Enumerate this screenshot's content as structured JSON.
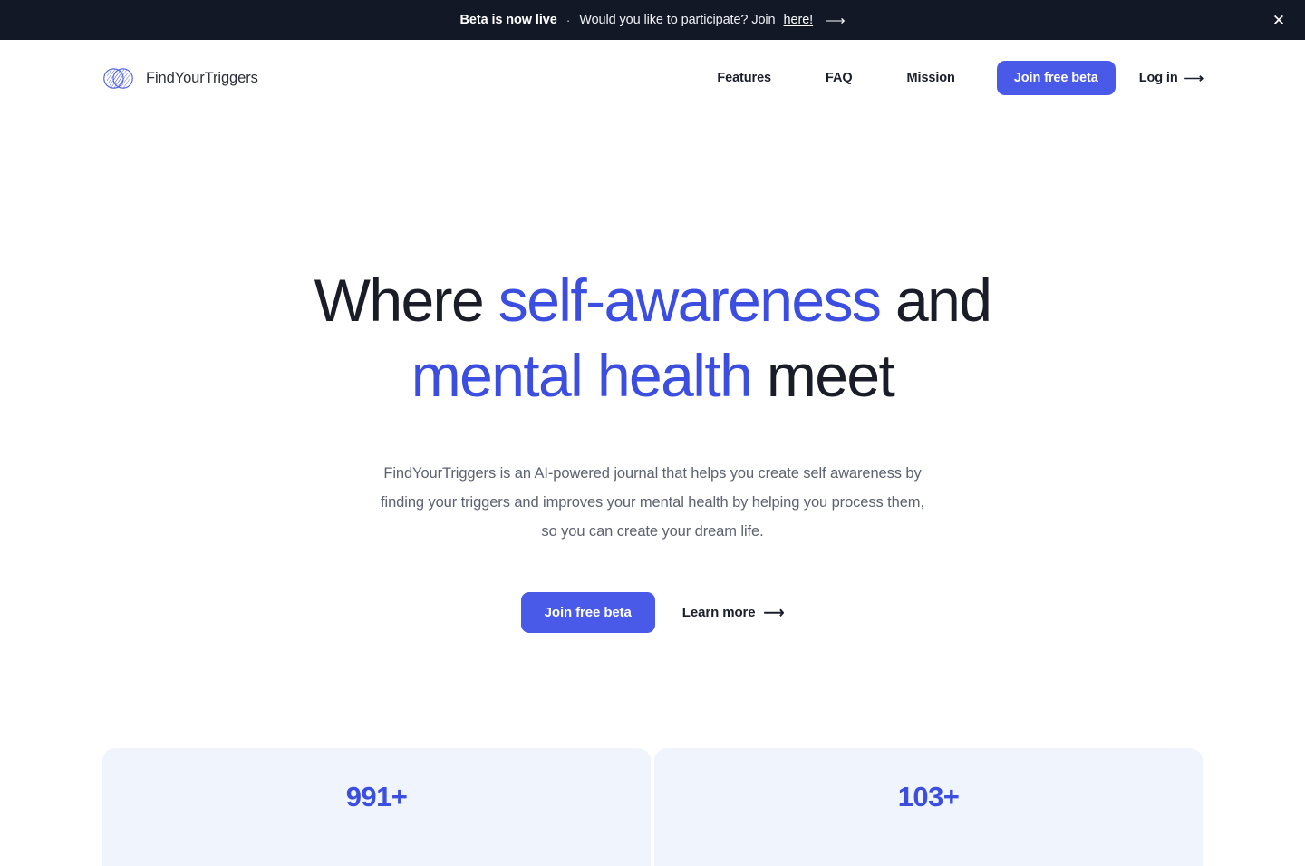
{
  "banner": {
    "strong": "Beta is now live",
    "separator": "·",
    "rest_before_link": "Would you like to participate? Join",
    "link_label": "here!",
    "arrow": "⟶",
    "close_icon": "✕"
  },
  "header": {
    "brand_name": "FindYourTriggers",
    "nav_links": [
      {
        "label": "Features"
      },
      {
        "label": "FAQ"
      },
      {
        "label": "Mission"
      }
    ],
    "cta_label": "Join free beta",
    "login_label": "Log in",
    "login_arrow": "⟶"
  },
  "hero": {
    "title_line1_part1": "Where ",
    "title_line1_highlight": "self-awareness",
    "title_line1_part2": " and",
    "title_line2_highlight": "mental health",
    "title_line2_part2": " meet",
    "subtitle": "FindYourTriggers is an AI-powered journal that helps you create self awareness by finding your triggers and improves your mental health by helping you process them, so you can create your dream life.",
    "primary_cta": "Join free beta",
    "secondary_cta": "Learn more",
    "secondary_arrow": "⟶"
  },
  "stats": [
    {
      "value": "991+",
      "label": ""
    },
    {
      "value": "103+",
      "label": ""
    }
  ],
  "colors": {
    "accent": "#4a5ae8",
    "accent_text": "#3c4ee0",
    "banner_bg": "#131827",
    "stat_card_bg": "#eff4fd",
    "body_text": "#5d6270",
    "heading_text": "#1a1d27"
  }
}
